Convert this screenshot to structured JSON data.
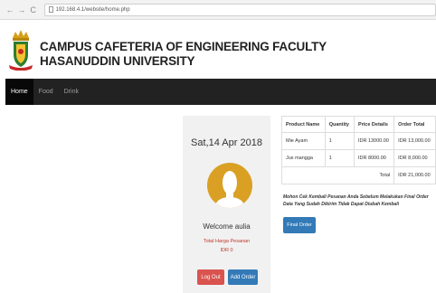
{
  "browser": {
    "back_glyph": "←",
    "forward_glyph": "→",
    "reload_glyph": "C",
    "url": "192.168.4.1/website/home.php"
  },
  "header": {
    "title_line1": "CAMPUS CAFETERIA OF ENGINEERING FACULTY",
    "title_line2": "HASANUDDIN UNIVERSITY",
    "logo_icon": "university-crest-icon"
  },
  "navbar": {
    "items": [
      {
        "label": "Home",
        "active": true
      },
      {
        "label": "Food",
        "active": false
      },
      {
        "label": "Drink",
        "active": false
      }
    ]
  },
  "profile_card": {
    "date": "Sat,14 Apr 2018",
    "avatar_icon": "user-silhouette-icon",
    "welcome": "Welcome aulia",
    "total_label": "Total Harga Pesanan",
    "total_value": "IDR 0",
    "logout_label": "Log Out",
    "add_order_label": "Add Order"
  },
  "order_table": {
    "headers": [
      "Product Name",
      "Quantity",
      "Price Details",
      "Order Total"
    ],
    "rows": [
      [
        "Mie Ayam",
        "1",
        "IDR 13000.00",
        "IDR 13,000.00"
      ],
      [
        "Jus mangga",
        "1",
        "IDR 8000.00",
        "IDR 8,000.00"
      ]
    ],
    "total_label": "Total",
    "total_value": "IDR 21,000.00"
  },
  "note": {
    "line1": "Mohon Cek Kembali Pesanan Anda Sebelum Melakukan Final Order",
    "line2": "Data Yang Sudah Dikirim Tidak Dapat Diubah Kembali"
  },
  "final_order_label": "Final Order",
  "colors": {
    "navbar": "#222222",
    "accent_blue": "#337ab7",
    "danger_red": "#d9534f",
    "avatar_gold": "#d9a024"
  }
}
